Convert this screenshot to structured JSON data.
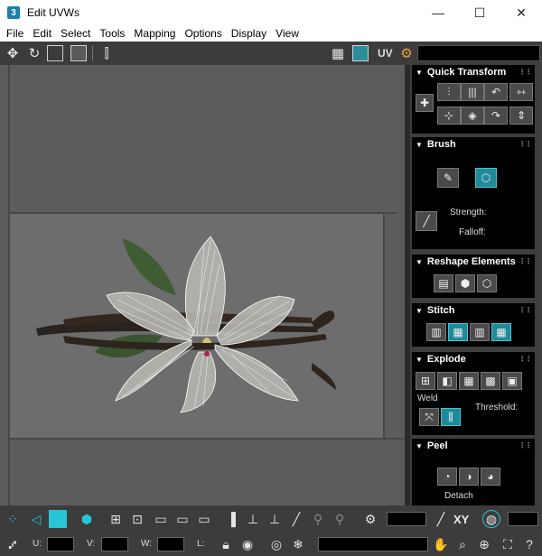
{
  "window": {
    "app_badge": "3",
    "title": "Edit UVWs",
    "minimize_glyph": "—",
    "maximize_glyph": "☐",
    "close_glyph": "✕"
  },
  "menu": [
    "File",
    "Edit",
    "Select",
    "Tools",
    "Mapping",
    "Options",
    "Display",
    "View"
  ],
  "toolbar_top": {
    "uv_label": "UV",
    "icons": [
      "move-icon",
      "rotate-icon",
      "scale-icon",
      "freeform-icon",
      "mirror-icon",
      "checker-pattern-icon",
      "texture-icon",
      "settings-icon"
    ]
  },
  "panels": {
    "quick_transform": {
      "title": "Quick Transform"
    },
    "brush": {
      "title": "Brush",
      "strength_label": "Strength:",
      "falloff_label": "Falloff:"
    },
    "reshape": {
      "title": "Reshape Elements"
    },
    "stitch": {
      "title": "Stitch"
    },
    "explode": {
      "title": "Explode",
      "weld_label": "Weld",
      "threshold_label": "Threshold:"
    },
    "peel": {
      "title": "Peel",
      "detach_label": "Detach"
    }
  },
  "bottom": {
    "xy_label": "XY",
    "u_label": "U:",
    "v_label": "V:",
    "w_label": "W:",
    "l_label": "L:"
  },
  "colors": {
    "accent_teal": "#28c5d6",
    "panel_bg": "#3e3e3e",
    "viewport_bg": "#5c5c5c"
  }
}
